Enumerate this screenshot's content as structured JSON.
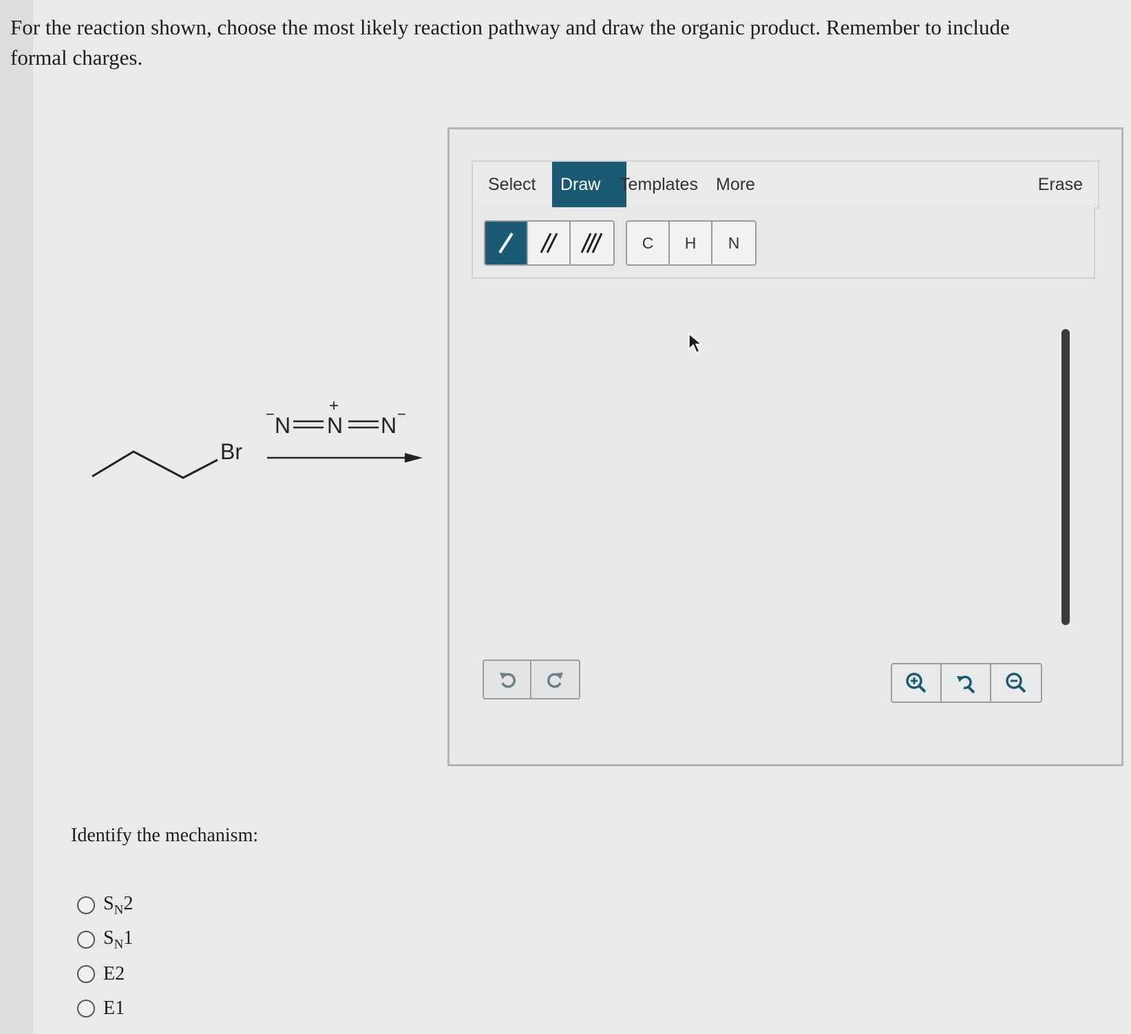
{
  "question": {
    "text": "For the reaction shown, choose the most likely reaction pathway and draw the organic product. Remember to include formal charges."
  },
  "reaction": {
    "leaving_group": "Br",
    "reagent_left_charge": "−",
    "reagent_center_charge": "+",
    "reagent_right_charge": "−",
    "reagent_atom": "N"
  },
  "mechanism": {
    "prompt": "Identify the mechanism:",
    "options": [
      {
        "base": "S",
        "sub": "N",
        "num": "2"
      },
      {
        "base": "S",
        "sub": "N",
        "num": "1"
      },
      {
        "base": "E2",
        "sub": "",
        "num": ""
      },
      {
        "base": "E1",
        "sub": "",
        "num": ""
      }
    ]
  },
  "editor": {
    "tabs": {
      "select": "Select",
      "draw": "Draw",
      "templates": "Templates",
      "more": "More",
      "erase": "Erase"
    },
    "active_tab": "Draw",
    "atoms": {
      "c": "C",
      "h": "H",
      "n": "N"
    },
    "accent_color": "#1a5a73"
  }
}
